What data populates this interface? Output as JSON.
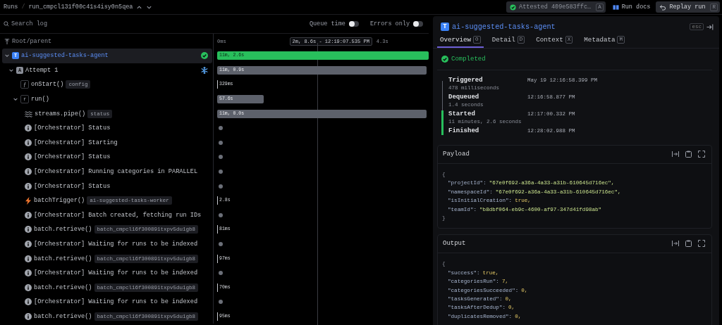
{
  "breadcrumb": {
    "section": "Runs",
    "separator": "/",
    "run_id": "run_cmpcl131f00c41s4isy0n5qea"
  },
  "header_buttons": [
    {
      "kind": "attested",
      "label": "Attested 409e583ffc…",
      "key": "A"
    },
    {
      "kind": "docs",
      "label": "Run docs"
    },
    {
      "kind": "replay",
      "label": "Replay run",
      "key": "R"
    }
  ],
  "search": {
    "placeholder": "Search log"
  },
  "toggles": [
    {
      "label": "Queue time",
      "on": false
    },
    {
      "label": "Errors only",
      "on": false
    }
  ],
  "tree_header": {
    "label": "Root/parent"
  },
  "timeline_header": {
    "start": "0ms",
    "cursor": "2m, 8.6s - 12:19:07.535 PM",
    "end": "4.3s"
  },
  "tree": [
    {
      "kind": "task",
      "badge": "T",
      "label": "ai-suggested-tasks-agent",
      "expanded": true,
      "selected": true,
      "completed": true,
      "span": {
        "kind": "bar",
        "success": true,
        "label": "11m, 2.6s",
        "level": 1
      },
      "children": [
        {
          "kind": "attempt",
          "badge": "A",
          "label": "Attempt 1",
          "expanded": true,
          "selected": false,
          "suspended": true,
          "span": {
            "kind": "bar",
            "success": false,
            "label": "11m, 0.9s",
            "level": 0.99
          },
          "children": [
            {
              "kind": "function",
              "badge": "ƒ",
              "label": "onStart()",
              "tag": "config",
              "selected": false,
              "span": {
                "kind": "tick",
                "label": "329ms"
              }
            },
            {
              "kind": "function",
              "badge": "r",
              "label": "run()",
              "expanded": true,
              "selected": false,
              "span": {
                "kind": "bar",
                "success": false,
                "label": "57.6s",
                "level": 0.22
              },
              "children": [
                {
                  "kind": "stream",
                  "label": "streams.pipe()",
                  "tag": "status",
                  "selected": false,
                  "span": {
                    "kind": "bar",
                    "success": false,
                    "label": "11m, 0.0s",
                    "level": 0.99
                  }
                },
                {
                  "kind": "info",
                  "label": "[Orchestrator] Status",
                  "selected": false,
                  "span": {
                    "kind": "dot"
                  }
                },
                {
                  "kind": "info",
                  "label": "[Orchestrator] Starting",
                  "selected": false,
                  "span": {
                    "kind": "dot"
                  }
                },
                {
                  "kind": "info",
                  "label": "[Orchestrator] Status",
                  "selected": false,
                  "span": {
                    "kind": "dot"
                  }
                },
                {
                  "kind": "info",
                  "label": "[Orchestrator] Running categories in PARALLEL",
                  "selected": false,
                  "span": {
                    "kind": "dot"
                  }
                },
                {
                  "kind": "info",
                  "label": "[Orchestrator] Status",
                  "selected": false,
                  "span": {
                    "kind": "dot"
                  }
                },
                {
                  "kind": "trigger",
                  "label": "batchTrigger()",
                  "tag": "ai-suggested-tasks-worker",
                  "selected": false,
                  "span": {
                    "kind": "tick",
                    "label": "2.8s"
                  }
                },
                {
                  "kind": "info",
                  "label": "[Orchestrator] Batch created, fetching run IDs",
                  "selected": false,
                  "span": {
                    "kind": "dot"
                  }
                },
                {
                  "kind": "info",
                  "label": "batch.retrieve()",
                  "tag": "batch_cmpcl16f300891txpv5du1gb8",
                  "selected": false,
                  "span": {
                    "kind": "tick",
                    "label": "81ms"
                  }
                },
                {
                  "kind": "info",
                  "label": "[Orchestrator] Waiting for runs to be indexed",
                  "selected": false,
                  "span": {
                    "kind": "dot"
                  }
                },
                {
                  "kind": "info",
                  "label": "batch.retrieve()",
                  "tag": "batch_cmpcl16f300891txpv5du1gb8",
                  "selected": false,
                  "span": {
                    "kind": "tick",
                    "label": "97ms"
                  }
                },
                {
                  "kind": "info",
                  "label": "[Orchestrator] Waiting for runs to be indexed",
                  "selected": false,
                  "span": {
                    "kind": "dot"
                  }
                },
                {
                  "kind": "info",
                  "label": "batch.retrieve()",
                  "tag": "batch_cmpcl16f300891txpv5du1gb8",
                  "selected": false,
                  "span": {
                    "kind": "tick",
                    "label": "70ms"
                  }
                },
                {
                  "kind": "info",
                  "label": "[Orchestrator] Waiting for runs to be indexed",
                  "selected": false,
                  "span": {
                    "kind": "dot"
                  }
                },
                {
                  "kind": "info",
                  "label": "batch.retrieve()",
                  "tag": "batch_cmpcl16f300891txpv5du1gb8",
                  "selected": false,
                  "span": {
                    "kind": "tick",
                    "label": "95ms"
                  }
                }
              ]
            }
          ]
        }
      ]
    }
  ],
  "detail": {
    "badge": "T",
    "title": "ai-suggested-tasks-agent",
    "close_key": "esc",
    "tabs": [
      {
        "label": "Overview",
        "key": "O",
        "selected": true
      },
      {
        "label": "Detail",
        "key": "D",
        "selected": false
      },
      {
        "label": "Context",
        "key": "X",
        "selected": false
      },
      {
        "label": "Metadata",
        "key": "M",
        "selected": false
      }
    ],
    "status": {
      "label": "Completed",
      "completed": true
    },
    "events": [
      {
        "label": "Triggered",
        "time": "May 19 12:16:58.399 PM",
        "duration": "478 milliseconds",
        "running": false
      },
      {
        "label": "Dequeued",
        "time": "12:16:58.877 PM",
        "duration": "1.4 seconds",
        "running": false
      },
      {
        "label": "Started",
        "time": "12:17:00.332 PM",
        "duration": "11 minutes, 2.6 seconds",
        "running": true
      },
      {
        "label": "Finished",
        "time": "12:28:02.988 PM",
        "running": true
      }
    ],
    "panels": [
      {
        "title": "Payload",
        "lines": [
          {
            "kind": "brace",
            "text": "{"
          },
          {
            "kind": "string",
            "key": "\"projectId\":",
            "value": "\"67e0f692-a36a-4a33-a31b-610645d716ec\","
          },
          {
            "kind": "string",
            "key": "\"namespaceId\":",
            "value": "\"67e0f692-a36a-4a33-a31b-610645d716ec\","
          },
          {
            "kind": "literal",
            "key": "\"isInitialCreation\":",
            "value": "true,"
          },
          {
            "kind": "string",
            "key": "\"teamId\":",
            "value": "\"b8dbf064-eb9c-4600-af97-347d41fd98ab\""
          },
          {
            "kind": "brace",
            "text": "}"
          }
        ]
      },
      {
        "title": "Output",
        "lines": [
          {
            "kind": "brace",
            "text": "{"
          },
          {
            "kind": "literal",
            "key": "\"success\":",
            "value": "true,"
          },
          {
            "kind": "literal",
            "key": "\"categoriesRun\":",
            "value": "7,"
          },
          {
            "kind": "literal",
            "key": "\"categoriesSucceeded\":",
            "value": "0,"
          },
          {
            "kind": "literal",
            "key": "\"tasksGenerated\":",
            "value": "0,"
          },
          {
            "kind": "literal",
            "key": "\"tasksAfterDedup\":",
            "value": "0,"
          },
          {
            "kind": "literal",
            "key": "\"duplicatesRemoved\":",
            "value": "0,"
          }
        ]
      }
    ]
  }
}
